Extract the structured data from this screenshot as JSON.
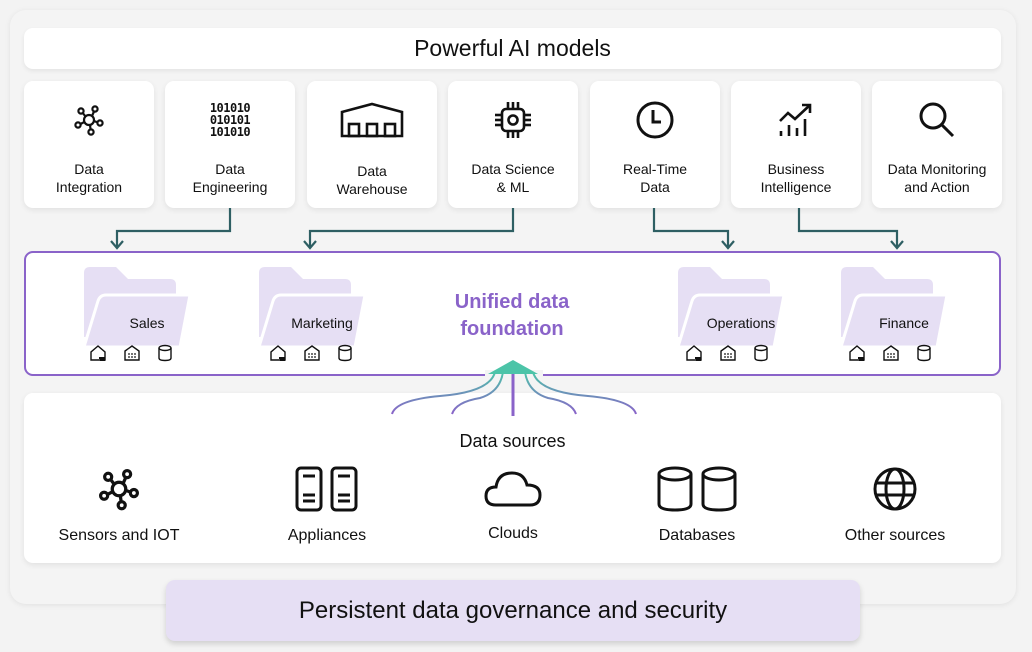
{
  "header": {
    "title": "Powerful AI models"
  },
  "capabilities": [
    {
      "label_line1": "Data",
      "label_line2": "Integration",
      "icon": "network-hub-icon"
    },
    {
      "label_line1": "Data",
      "label_line2": "Engineering",
      "icon": "binary-code-icon",
      "binary": [
        "101010",
        "010101",
        "101010"
      ]
    },
    {
      "label_line1": "Data",
      "label_line2": "Warehouse",
      "icon": "warehouse-icon"
    },
    {
      "label_line1": "Data Science",
      "label_line2": "& ML",
      "icon": "chip-icon"
    },
    {
      "label_line1": "Real-Time",
      "label_line2": "Data",
      "icon": "clock-icon"
    },
    {
      "label_line1": "Business",
      "label_line2": "Intelligence",
      "icon": "trend-chart-icon"
    },
    {
      "label_line1": "Data Monitoring",
      "label_line2": "and Action",
      "icon": "magnifier-icon"
    }
  ],
  "foundation": {
    "title_line1": "Unified data",
    "title_line2": "foundation",
    "domains": [
      {
        "name": "Sales"
      },
      {
        "name": "Marketing"
      },
      {
        "name": "Operations"
      },
      {
        "name": "Finance"
      }
    ],
    "domain_icons": [
      "lakehouse-icon",
      "warehouse-small-icon",
      "database-icon"
    ]
  },
  "sources": {
    "title": "Data sources",
    "items": [
      {
        "label": "Sensors and IOT",
        "icon": "network-hub-icon"
      },
      {
        "label": "Appliances",
        "icon": "server-icon"
      },
      {
        "label": "Clouds",
        "icon": "cloud-icon"
      },
      {
        "label": "Databases",
        "icon": "databases-icon"
      },
      {
        "label": "Other sources",
        "icon": "globe-icon"
      }
    ]
  },
  "footer": {
    "governance": "Persistent data governance and security"
  },
  "colors": {
    "accent_purple": "#8a63c9",
    "connector_teal": "#2e5f63",
    "arrow_teal": "#4cc4a8",
    "folder_fill": "#e6dff4"
  }
}
